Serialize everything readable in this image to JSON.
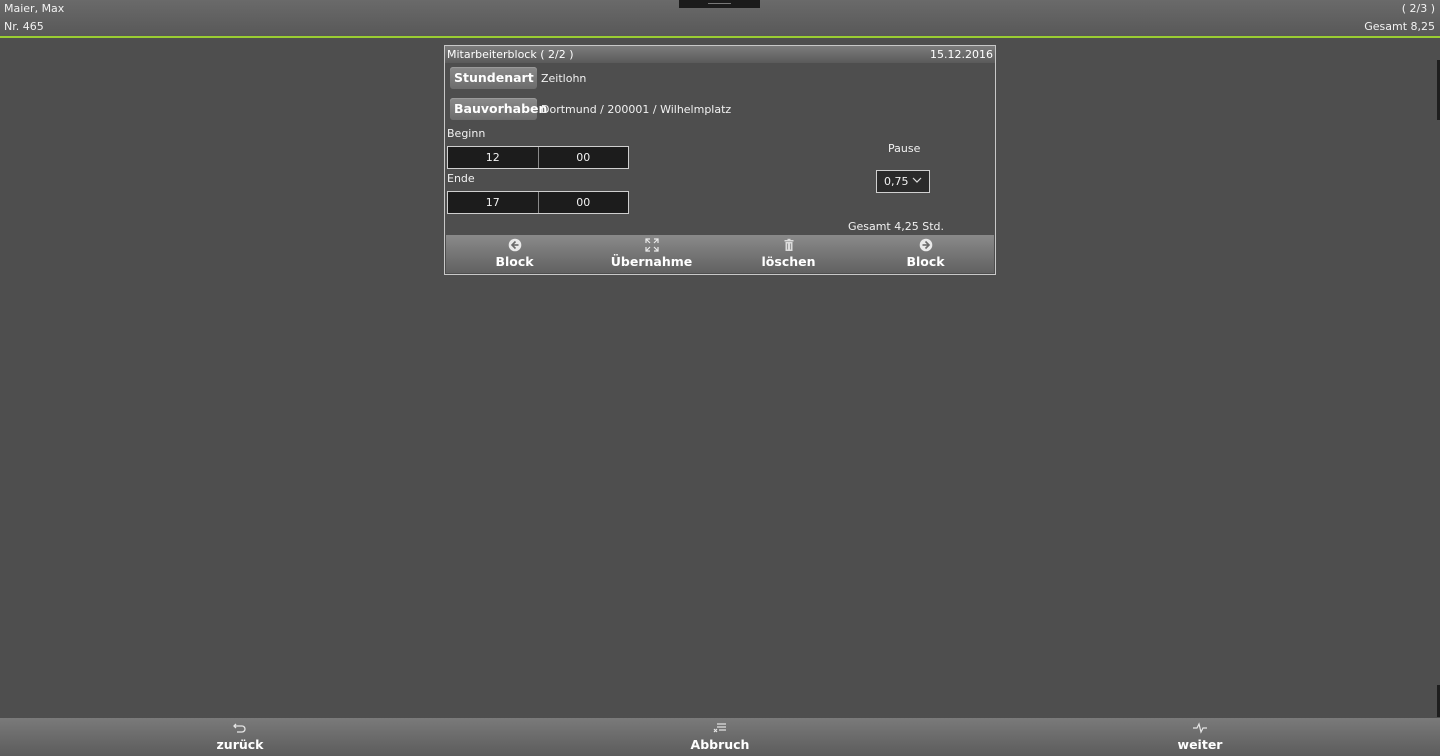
{
  "header": {
    "employee_name": "Maier, Max",
    "employee_nr": "Nr. 465",
    "page_indicator": "( 2/3 )",
    "total": "Gesamt 8,25"
  },
  "panel": {
    "title": "Mitarbeiterblock ( 2/2 )",
    "date": "15.12.2016",
    "stundenart_label": "Stundenart",
    "stundenart_value": "Zeitlohn",
    "bauvorhaben_label": "Bauvorhaben",
    "bauvorhaben_value": "Dortmund / 200001 / Wilhelmplatz",
    "beginn_label": "Beginn",
    "beginn_hour": "12",
    "beginn_minute": "00",
    "ende_label": "Ende",
    "ende_hour": "17",
    "ende_minute": "00",
    "pause_label": "Pause",
    "pause_value": "0,75",
    "total": "Gesamt 4,25 Std."
  },
  "actions": [
    {
      "label": "Block",
      "icon": "arrow-left-circle-icon"
    },
    {
      "label": "Übernahme",
      "icon": "expand-icon"
    },
    {
      "label": "löschen",
      "icon": "trash-icon"
    },
    {
      "label": "Block",
      "icon": "arrow-right-circle-icon"
    }
  ],
  "bottom": {
    "back_label": "zurück",
    "cancel_label": "Abbruch",
    "next_label": "weiter"
  },
  "colors": {
    "background": "#4e4e4e",
    "accent_line": "#9acd32"
  }
}
